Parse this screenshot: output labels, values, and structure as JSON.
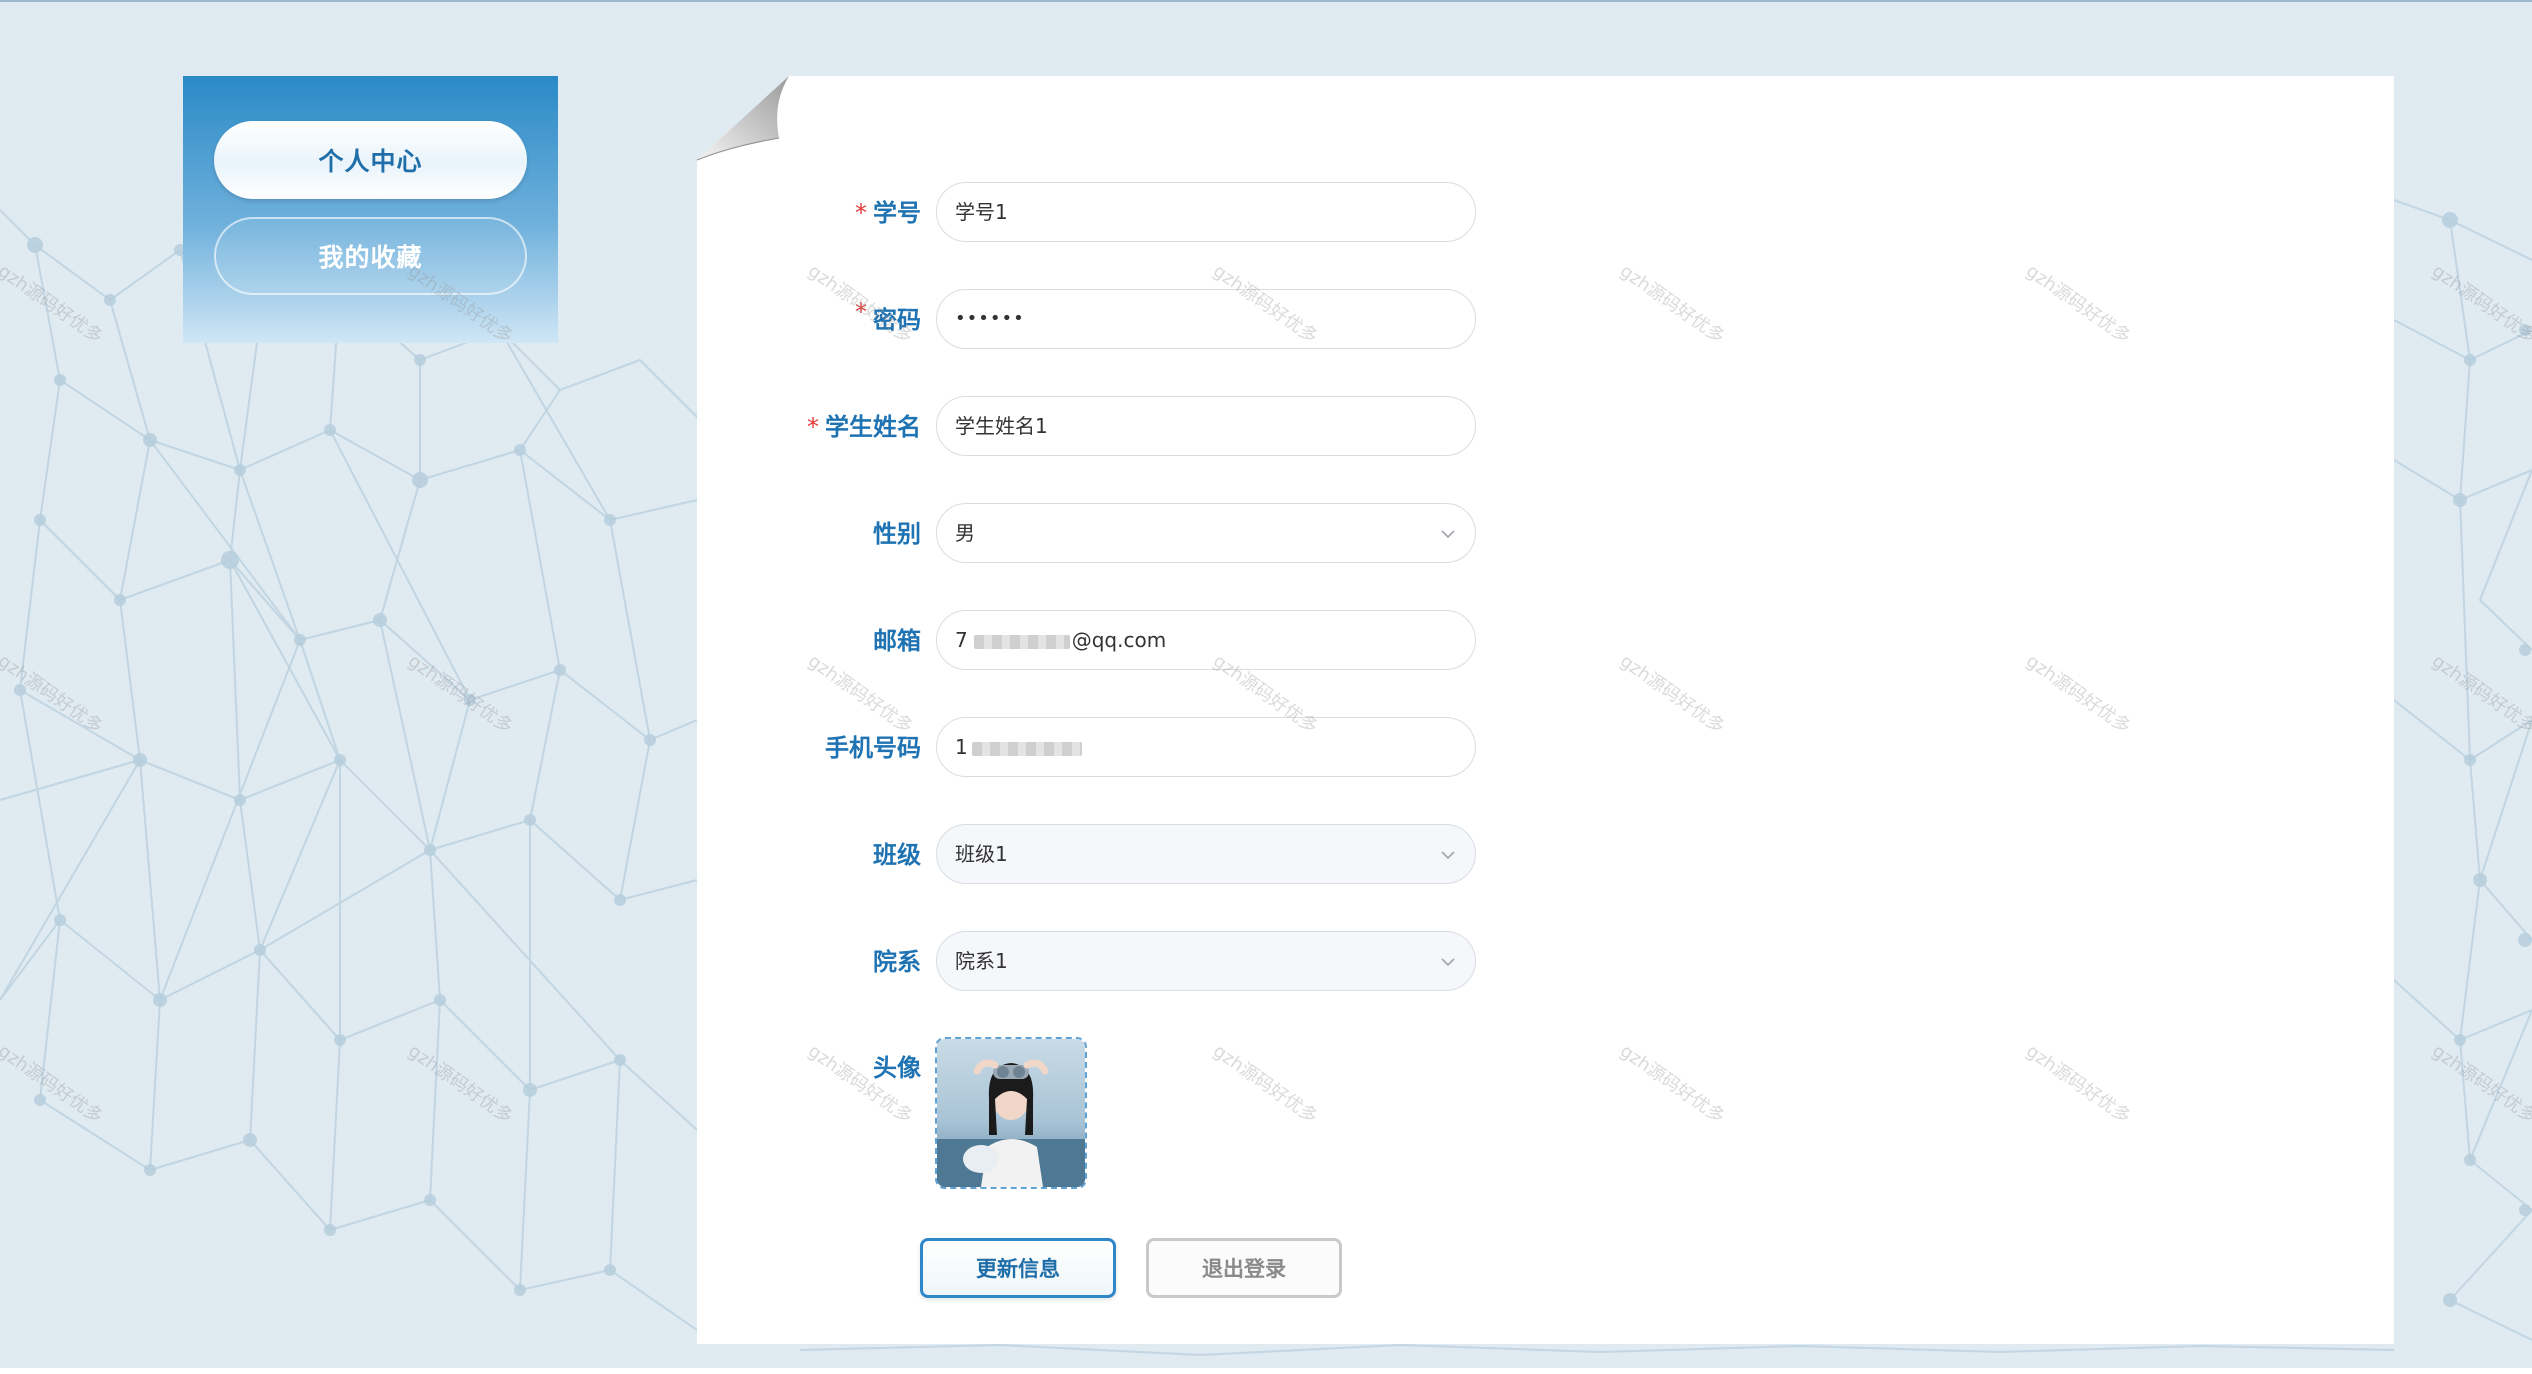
{
  "sidebar": {
    "items": [
      {
        "label": "个人中心",
        "active": true
      },
      {
        "label": "我的收藏",
        "active": false
      }
    ]
  },
  "form": {
    "student_id": {
      "label": "学号",
      "required": true,
      "value": "学号1"
    },
    "password": {
      "label": "密码",
      "required": true,
      "value": "••••••"
    },
    "student_name": {
      "label": "学生姓名",
      "required": true,
      "value": "学生姓名1"
    },
    "gender": {
      "label": "性别",
      "value": "男",
      "control": "select"
    },
    "email": {
      "label": "邮箱",
      "value_prefix": "7",
      "value_suffix": "@qq.com"
    },
    "phone": {
      "label": "手机号码",
      "value_prefix": "1"
    },
    "class": {
      "label": "班级",
      "value": "班级1",
      "control": "select",
      "disabled": true
    },
    "department": {
      "label": "院系",
      "value": "院系1",
      "control": "select",
      "disabled": true
    },
    "avatar": {
      "label": "头像"
    }
  },
  "required_marker": "*",
  "buttons": {
    "update": "更新信息",
    "logout": "退出登录"
  },
  "watermark": "gzh源码好优多",
  "colors": {
    "accent": "#1f73b3",
    "required": "#e43a3a",
    "sidebar_top": "#2a8ac6",
    "background": "#dfeaf1"
  }
}
